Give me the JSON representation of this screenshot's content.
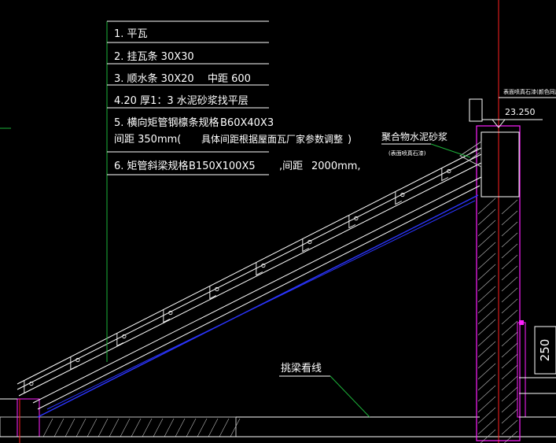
{
  "colors": {
    "background": "#000000",
    "text": "#ffffff",
    "leader": "#ffffff",
    "green": "#1db33a",
    "blue": "#2b35ff",
    "red": "#ff2020",
    "magenta": "#ff20ff",
    "grey": "#bdbdbd",
    "cyan": "#a9d8ff"
  },
  "notes": {
    "item1": "1. 平瓦",
    "item2": "2. 挂瓦条 30X30",
    "item3_a": "3. 顺水条 30X20",
    "item3_b": "中距 600",
    "item4": "4.20 厚1：3 水泥砂浆找平层",
    "item5_a": "5. 横向矩管钢檩条规格",
    "item5_b": "B60X40X3",
    "item5_c": "间距 350mm(",
    "item5_d": "具体间距根据屋面瓦厂家参数调整",
    "item5_e": ")",
    "item6_a": "6. 矩管斜梁规格",
    "item6_b": "B150X100X5",
    "item6_c": ",间距",
    "item6_d": "2000mm,"
  },
  "labels": {
    "mortar": "聚合物水泥砂浆",
    "mortar_sub": "(表面喷真石漆)",
    "top_note": "表面喷真石漆(颜色同周",
    "elevation": "23.250",
    "cornice_line": "挑梁看线",
    "dim_250": "250"
  }
}
